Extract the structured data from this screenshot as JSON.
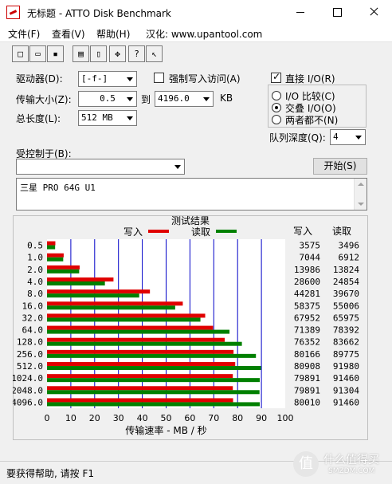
{
  "window": {
    "title": "无标题 - ATTO Disk Benchmark"
  },
  "menu": {
    "items": [
      "文件(F)",
      "查看(V)",
      "帮助(H)",
      "汉化: www.upantool.com"
    ]
  },
  "toolbar": {
    "icons": [
      "new-icon",
      "open-icon",
      "save-icon",
      "print-icon",
      "print-preview-icon",
      "move-icon",
      "help-icon",
      "context-help-icon"
    ]
  },
  "settings": {
    "drive_label": "驱动器(D):",
    "drive_value": "[-f-]",
    "force_write_label": "强制写入访问(A)",
    "force_write_checked": false,
    "transfer_size_label": "传输大小(Z):",
    "transfer_from": "0.5",
    "to_label": "到",
    "transfer_to": "4196.0",
    "kb_label": "KB",
    "total_length_label": "总长度(L):",
    "total_length_value": "512 MB",
    "controlled_by_label": "受控制于(B):",
    "controlled_by_value": "",
    "direct_io_label": "直接 I/O(R)",
    "direct_io_checked": true,
    "io_compare_label": "I/O 比较(C)",
    "overlap_io_label": "交叠 I/O(O)",
    "neither_label": "两者都不(N)",
    "selected_io_mode": "overlap",
    "queue_depth_label": "队列深度(Q):",
    "queue_depth_value": "4",
    "start_button": "开始(S)",
    "description_text": "三星 PRO  64G U1"
  },
  "results": {
    "title": "测试结果",
    "legend_write": "写入",
    "legend_read": "读取",
    "col_write": "写入",
    "col_read": "读取"
  },
  "chart_data": {
    "type": "bar",
    "orientation": "horizontal",
    "title": "测试结果",
    "xlabel": "传输速率 - MB / 秒",
    "xlim": [
      0,
      100
    ],
    "xticks": [
      "0",
      "10",
      "20",
      "30",
      "40",
      "50",
      "60",
      "70",
      "80",
      "90",
      "100"
    ],
    "grid": true,
    "legend_position": "top",
    "categories": [
      "0.5",
      "1.0",
      "2.0",
      "4.0",
      "8.0",
      "16.0",
      "32.0",
      "64.0",
      "128.0",
      "256.0",
      "512.0",
      "1024.0",
      "2048.0",
      "4096.0"
    ],
    "series": [
      {
        "name": "写入",
        "color": "#e00000",
        "values": [
          3.5,
          7.0,
          13.7,
          27.9,
          43.2,
          57.0,
          66.4,
          69.7,
          74.6,
          78.3,
          79.0,
          78.0,
          78.0,
          78.1
        ]
      },
      {
        "name": "读取",
        "color": "#008000",
        "values": [
          3.4,
          6.8,
          13.5,
          24.3,
          38.7,
          53.8,
          64.4,
          76.6,
          81.8,
          87.7,
          89.8,
          89.3,
          89.2,
          89.3
        ]
      }
    ],
    "table_write": [
      "3575",
      "7044",
      "13986",
      "28600",
      "44281",
      "58375",
      "67952",
      "71389",
      "76352",
      "80166",
      "80908",
      "79891",
      "79891",
      "80010"
    ],
    "table_read": [
      "3496",
      "6912",
      "13824",
      "24854",
      "39670",
      "55006",
      "65975",
      "78392",
      "83662",
      "89775",
      "91980",
      "91460",
      "91304",
      "91460"
    ]
  },
  "status": {
    "text": "要获得帮助, 请按 F1"
  },
  "watermark": {
    "text": "什么值得买",
    "logo": "值",
    "sub": "SMZDM.COM"
  }
}
